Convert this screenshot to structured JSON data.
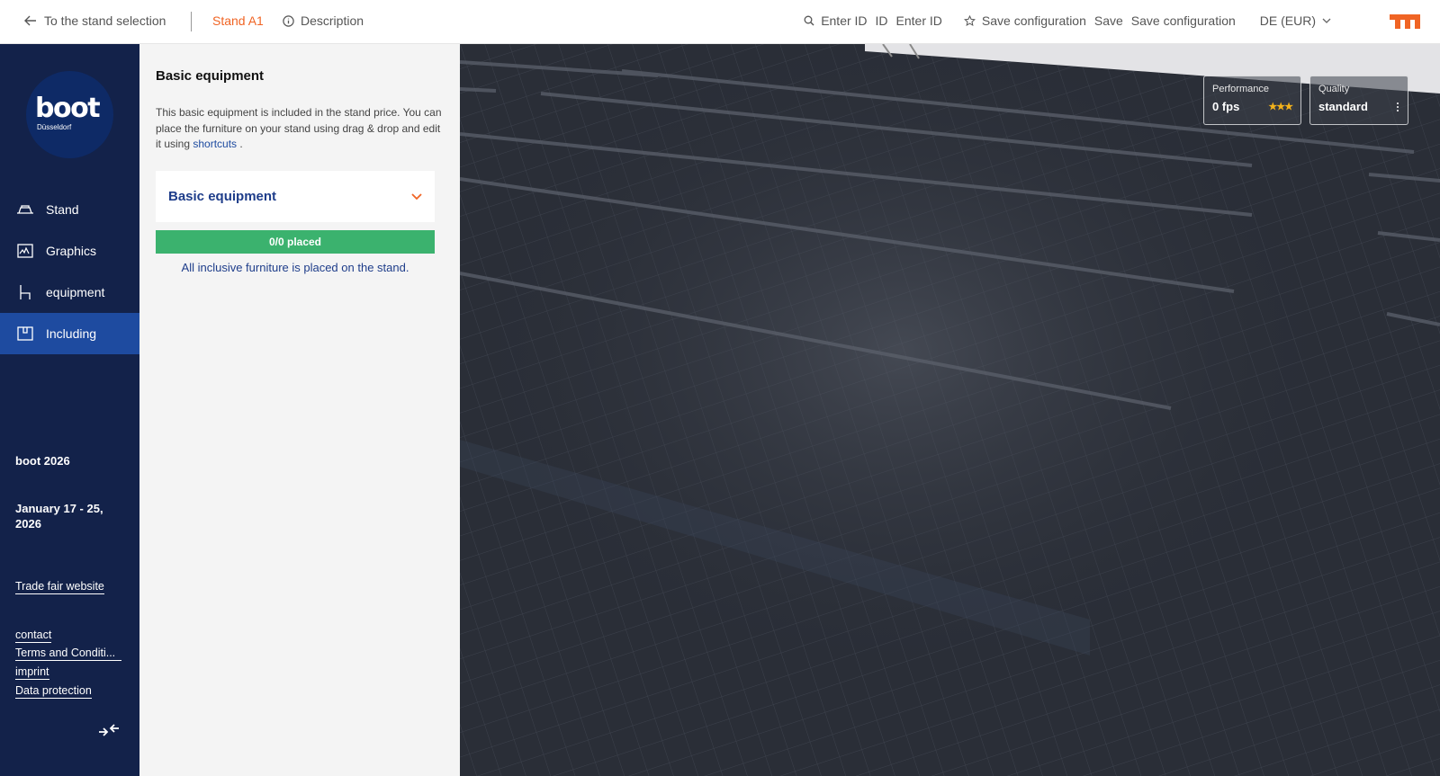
{
  "topbar": {
    "back_label": "To the stand selection",
    "stand_label": "Stand A1",
    "description_label": "Description",
    "search_placeholder": "Enter ID",
    "id_label": "ID",
    "id_placeholder": "Enter ID",
    "save_config_label": "Save configuration",
    "save_label": "Save",
    "save_config_label_2": "Save configuration",
    "currency_label": "DE (EUR)",
    "accent_color": "#f06424"
  },
  "sidebar": {
    "brand_word": "boot",
    "brand_city": "Düsseldorf",
    "items": [
      {
        "label": "Stand",
        "icon": "stand-icon"
      },
      {
        "label": "Graphics",
        "icon": "graphics-icon"
      },
      {
        "label": "equipment",
        "icon": "chair-icon"
      },
      {
        "label": "Including",
        "icon": "package-icon",
        "active": true
      }
    ],
    "event_name": "boot 2026",
    "event_dates": "January 17 - 25, 2026",
    "trade_fair_link": "Trade fair website",
    "links": [
      "contact",
      "Terms and Conditi...",
      "imprint",
      "Data protection"
    ],
    "bg_color": "#13224a",
    "active_color": "#1e4ba0"
  },
  "panel": {
    "title": "Basic equipment",
    "description": "This basic equipment is included in the stand price. You can place the furniture on your stand using drag & drop and edit it using",
    "shortcuts_link": "shortcuts",
    "description_end": " .",
    "accordion_label": "Basic equipment",
    "progress_label": "0/0 placed",
    "progress_color": "#3bb26e",
    "status_message": "All inclusive furniture is placed on the stand."
  },
  "viewport": {
    "performance_label": "Performance",
    "performance_value": "0 fps",
    "performance_stars": "★★★",
    "quality_label": "Quality",
    "quality_value": "standard"
  }
}
